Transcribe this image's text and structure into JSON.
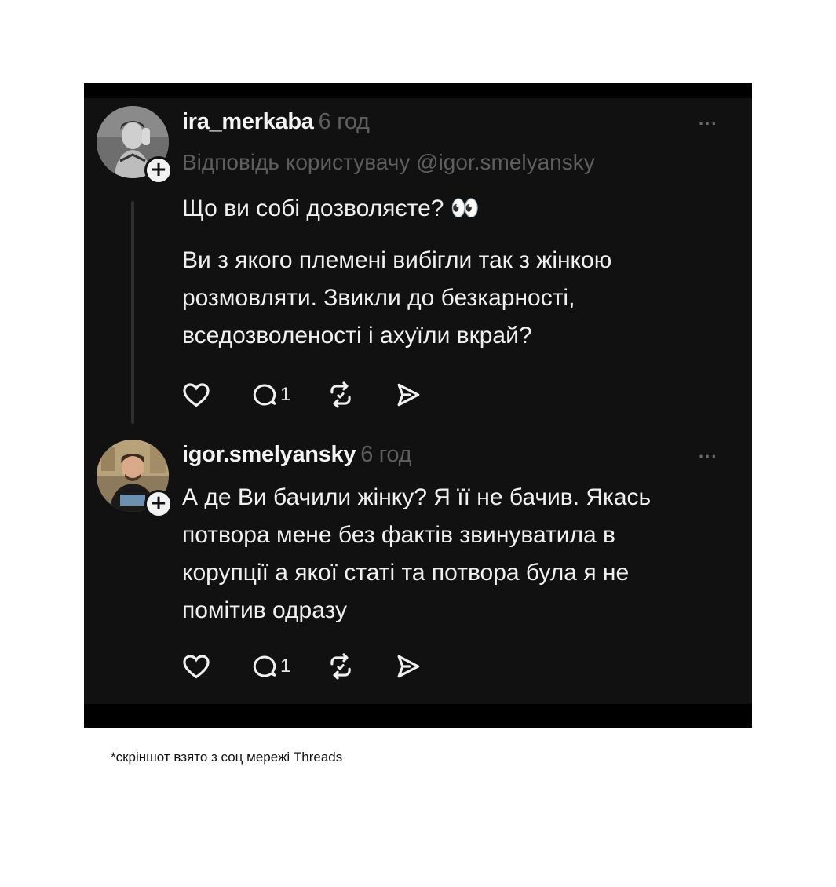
{
  "posts": [
    {
      "username": "ira_merkaba",
      "time": "6 год",
      "more": "...",
      "reply_to": "Відповідь користувачу @igor.smelyansky",
      "lines": [
        "Що ви собі дозволяєте? 👀",
        "Ви з якого племені вибігли так з жінкою",
        "розмовляти. Звикли до безкарності,",
        "вседозволеності і ахуїли вкрай?"
      ],
      "reply_count": "1",
      "follow": "+"
    },
    {
      "username": "igor.smelyansky",
      "time": "6 год",
      "more": "...",
      "lines": [
        "А де Ви бачили жінку? Я її не бачив. Якась",
        "потвора мене без фактів звинуватила в",
        "корупції а якої статі та потвора була я не",
        "помітив одразу"
      ],
      "reply_count": "1",
      "follow": "+"
    }
  ],
  "icons": [
    "heart-icon",
    "comment-icon",
    "repost-icon",
    "share-icon",
    "more-icon",
    "follow-plus-icon"
  ],
  "colors": {
    "background": "#111111",
    "text": "#f0f0f0",
    "muted": "#5e5e5e"
  },
  "caption": "*скріншот взято з соц мережі Threads"
}
